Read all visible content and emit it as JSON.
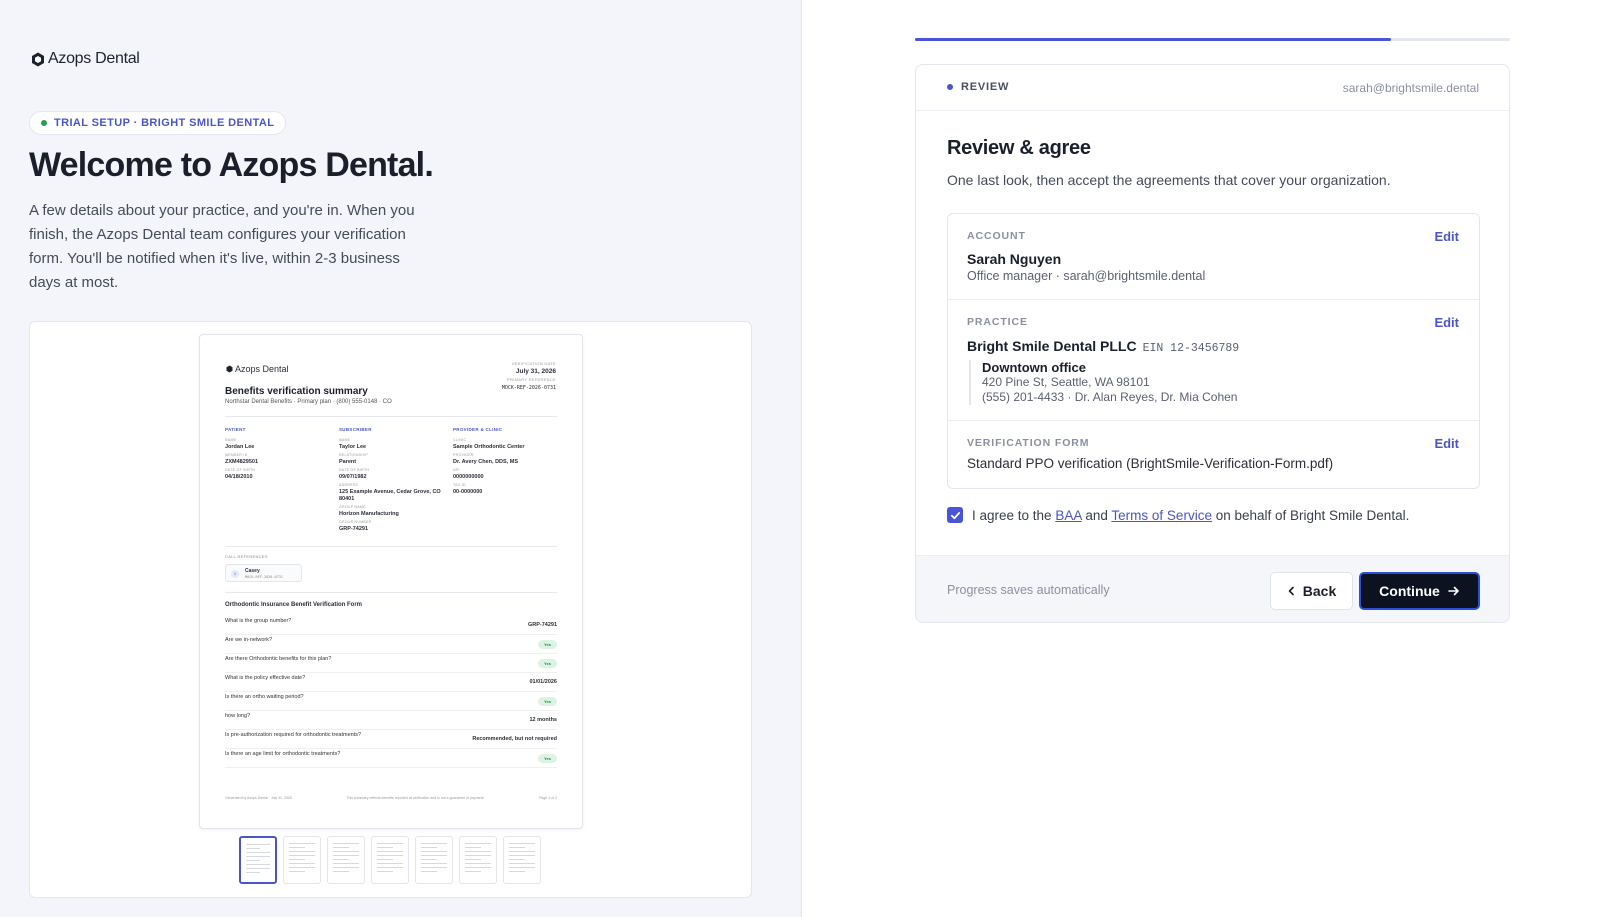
{
  "brand": {
    "name": "Azops Dental"
  },
  "left": {
    "pill": "TRIAL SETUP · BRIGHT SMILE DENTAL",
    "title": "Welcome to Azops Dental.",
    "intro": "A few details about your practice, and you're in. When you finish, the Azops Dental team configures your verification form. You'll be notified when it's live, within 2-3 business days at most."
  },
  "doc": {
    "logo": "Azops Dental",
    "title": "Benefits verification summary",
    "subtitle": "Northstar Dental Benefits · Primary plan · (800) 555-0148 · CO",
    "meta": {
      "date_label": "VERIFICATION DATE",
      "date": "July 31, 2026",
      "ref_label": "PRIMARY REFERENCE",
      "ref": "MOCK-REF-2026-0731"
    },
    "patient": {
      "head": "PATIENT",
      "name_label": "NAME",
      "name": "Jordan Lee",
      "member_label": "MEMBER ID",
      "member": "ZXM4829501",
      "dob_label": "DATE OF BIRTH",
      "dob": "04/18/2010"
    },
    "subscriber": {
      "head": "SUBSCRIBER",
      "name_label": "NAME",
      "name": "Taylor Lee",
      "rel_label": "RELATIONSHIP",
      "rel": "Parent",
      "dob_label": "DATE OF BIRTH",
      "dob": "09/07/1982",
      "addr_label": "ADDRESS",
      "addr": "125 Example Avenue, Cedar Grove, CO 80401",
      "group_label": "GROUP NAME",
      "group": "Horizon Manufacturing",
      "gnum_label": "GROUP NUMBER",
      "gnum": "GRP-74291"
    },
    "provider": {
      "head": "PROVIDER & CLINIC",
      "clinic_label": "CLINIC",
      "clinic": "Sample Orthodontic Center",
      "prov_label": "PROVIDER",
      "prov": "Dr. Avery Chen, DDS, MS",
      "npi_label": "NPI",
      "npi": "0000000000",
      "tax_label": "TAX ID",
      "tax": "00-0000000"
    },
    "call": {
      "head": "CALL REFERENCES",
      "num": "1",
      "name": "Casey",
      "ref": "MOCK-REF-2026-0731"
    },
    "form_title": "Orthodontic Insurance Benefit Verification Form",
    "qa": [
      {
        "q": "What is the group number?",
        "a": "GRP-74291"
      },
      {
        "q": "Are we in-network?",
        "yes": "Yes"
      },
      {
        "q": "Are there Orthodontic benefits for this plan?",
        "yes": "Yes"
      },
      {
        "q": "What is the policy effective date?",
        "a": "01/01/2026"
      },
      {
        "q": "Is there an ortho waiting period?",
        "yes": "Yes"
      },
      {
        "q": "how long?",
        "a": "12 months"
      },
      {
        "q": "Is pre-authorization required for orthodontic treatments?",
        "a": "Recommended, but not required"
      },
      {
        "q": "Is there an age limit for orthodontic treatments?",
        "yes": "Yes"
      }
    ],
    "footer": {
      "left": "Generated by Azops Dental · July 31, 2026",
      "mid": "This summary reflects benefits reported at verification and is not a guarantee of payment.",
      "right": "Page 1 of 2"
    }
  },
  "progress": {
    "fraction": 0.8
  },
  "card": {
    "step": "REVIEW",
    "email": "sarah@brightsmile.dental",
    "title": "Review & agree",
    "lead": "One last look, then accept the agreements that cover your organization.",
    "account": {
      "label": "ACCOUNT",
      "edit": "Edit",
      "name": "Sarah Nguyen",
      "detail": "Office manager · sarah@brightsmile.dental"
    },
    "practice": {
      "label": "PRACTICE",
      "edit": "Edit",
      "name": "Bright Smile Dental PLLC",
      "ein": "EIN 12-3456789",
      "office_name": "Downtown office",
      "office_addr": "420 Pine St, Seattle, WA 98101",
      "office_contact": "(555) 201-4433 · Dr. Alan Reyes, Dr. Mia Cohen"
    },
    "form": {
      "label": "VERIFICATION FORM",
      "edit": "Edit",
      "value": "Standard PPO verification (BrightSmile-Verification-Form.pdf)"
    },
    "agree": {
      "pre": "I agree to the",
      "baa": "BAA",
      "and": "and",
      "tos": "Terms of Service",
      "post": "on behalf of Bright Smile Dental.",
      "checked": true
    },
    "footer": {
      "saves": "Progress saves automatically",
      "back": "Back",
      "continue": "Continue"
    }
  },
  "colors": {
    "accent": "#4b53d6",
    "primary_button": "#0d1220",
    "link": "#4a55c8"
  }
}
